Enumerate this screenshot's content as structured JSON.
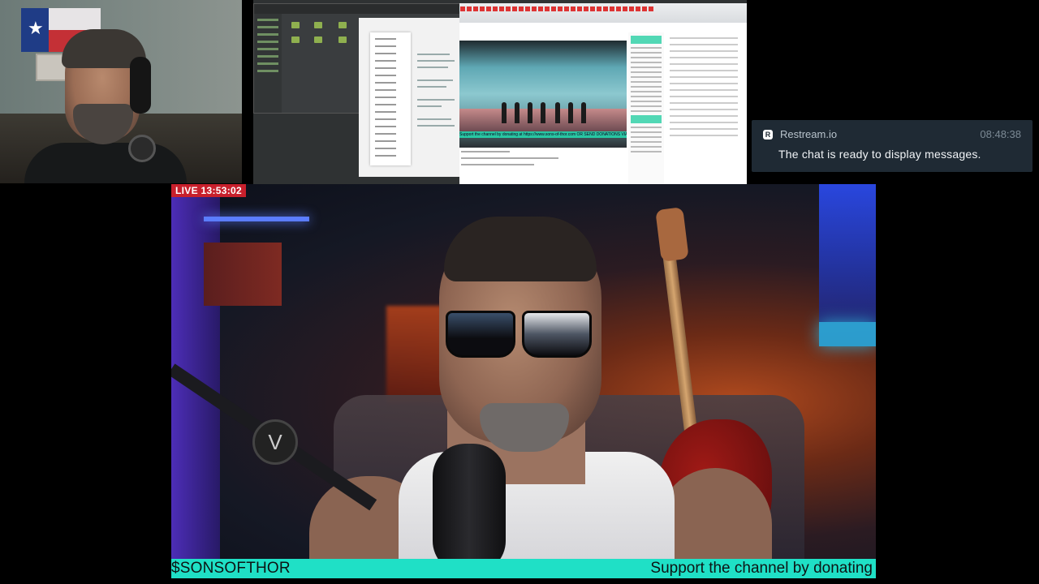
{
  "chat_panel": {
    "source": "Restream.io",
    "time": "08:48:38",
    "message": "The chat is ready to display messages."
  },
  "main_cam": {
    "live_label": "LIVE 13:53:02"
  },
  "ticker": {
    "handle": "$SONSOFTHOR",
    "support_text": "Support the channel by donating"
  },
  "desktop_capture": {
    "video_ticker": "Support the channel by donating at https://www.sons-of-thor.com OR SEND DONATIONS VIA"
  },
  "colors": {
    "ticker_bg": "#1fe0c6",
    "live_badge_bg": "#c8202c",
    "chat_panel_bg": "#1f2a34"
  },
  "icons": {
    "restream_logo": "restream-logo-icon",
    "mic_logo": "microphone-logo-icon"
  }
}
